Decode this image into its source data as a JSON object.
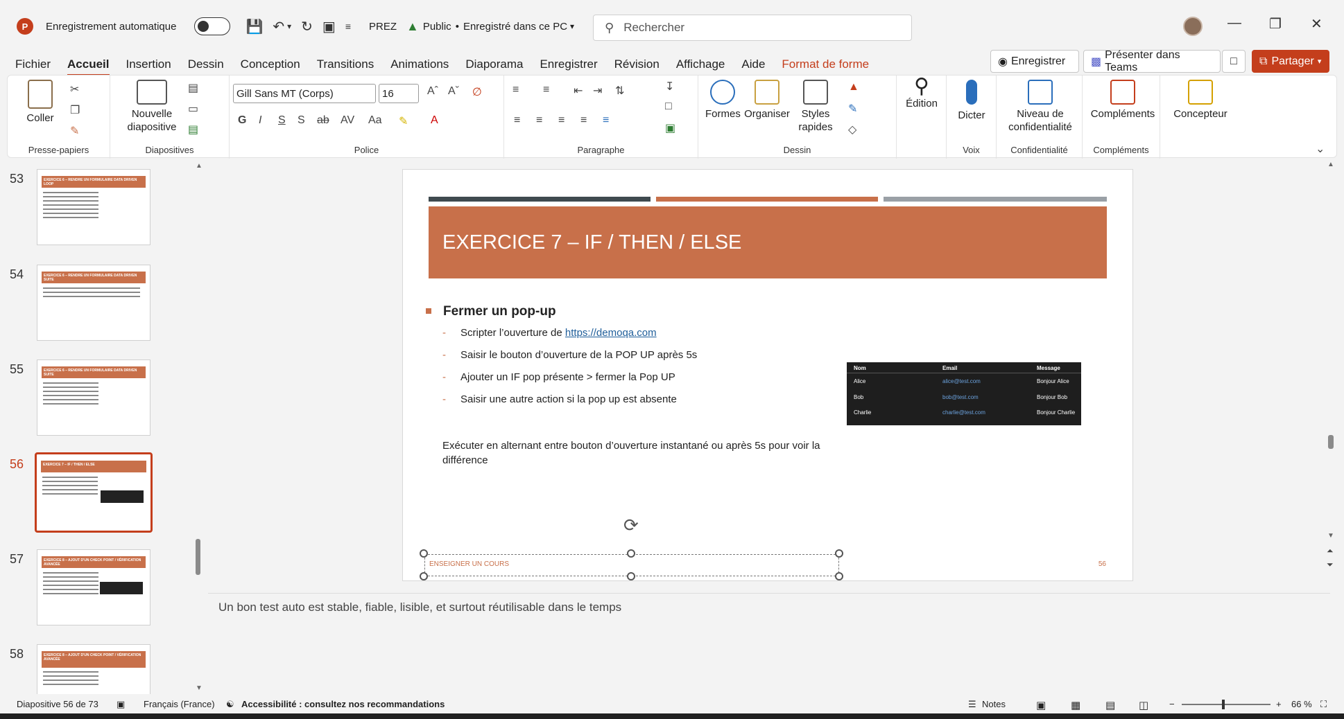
{
  "titlebar": {
    "app_icon": "P",
    "autosave_label": "Enregistrement automatique",
    "doc_name": "PREZ",
    "sensitivity": "Public",
    "separator": "•",
    "save_state": "Enregistré dans ce PC",
    "search_placeholder": "Rechercher",
    "icons": [
      "save-icon",
      "undo-icon",
      "redo-icon",
      "present-icon",
      "customize-icon"
    ]
  },
  "menu": {
    "items": [
      "Fichier",
      "Accueil",
      "Insertion",
      "Dessin",
      "Conception",
      "Transitions",
      "Animations",
      "Diaporama",
      "Enregistrer",
      "Révision",
      "Affichage",
      "Aide",
      "Format de forme"
    ],
    "record_button": "Enregistrer",
    "teams_button": "Présenter dans Teams",
    "share_button": "Partager"
  },
  "ribbon": {
    "groups": {
      "clipboard": "Presse-papiers",
      "slides": "Diapositives",
      "font": "Police",
      "paragraph": "Paragraphe",
      "drawing": "Dessin",
      "voice": "Voix",
      "confidentiality": "Confidentialité",
      "addins": "Compléments"
    },
    "paste_label": "Coller",
    "new_slide_label": "Nouvelle",
    "new_slide_label2": "diapositive",
    "font_name": "Gill Sans MT (Corps)",
    "font_size": "16",
    "shapes_label": "Formes",
    "arrange_label": "Organiser",
    "styles_label": "Styles",
    "styles_label2": "rapides",
    "edit_label": "Édition",
    "dictate_label": "Dicter",
    "sensitivity_label": "Niveau de",
    "sensitivity_label2": "confidentialité",
    "addins_label": "Compléments",
    "designer_label": "Concepteur"
  },
  "thumbnails": [
    {
      "num": "53",
      "title": "EXERCICE 6 – RENDRE UN FORMULAIRE DATA DRIVEN LOOP"
    },
    {
      "num": "54",
      "title": "EXERCICE 6 – RENDRE UN FORMULAIRE DATA DRIVEN SUITE"
    },
    {
      "num": "55",
      "title": "EXERCICE 6 – RENDRE UN FORMULAIRE DATA DRIVEN SUITE"
    },
    {
      "num": "56",
      "title": "EXERCICE 7 – IF / THEN / ELSE"
    },
    {
      "num": "57",
      "title": "EXERCICE 8 – AJOUT D'UN CHECK POINT / VÉRIFICATION AVANCÉE"
    },
    {
      "num": "58",
      "title": "EXERCICE 8 – AJOUT D'UN CHECK POINT / VÉRIFICATION AVANCÉE"
    }
  ],
  "slide": {
    "title": "EXERCICE 7 – IF  / THEN / ELSE",
    "main_bullet": "Fermer un pop-up",
    "sub1_prefix": "Scripter l’ouverture de ",
    "sub1_link": "https://demoqa.com",
    "sub2": "Saisir le bouton d’ouverture de la POP UP après 5s",
    "sub3": "Ajouter un IF pop présente > fermer la Pop UP",
    "sub4": "Saisir une autre action si la pop up est absente",
    "note": "Exécuter en alternant entre bouton d’ouverture instantané ou après 5s pour voir la différence",
    "footer": "ENSEIGNER UN COURS",
    "page_number": "56",
    "table": {
      "headers": [
        "Nom",
        "Email",
        "Message"
      ],
      "rows": [
        [
          "Alice",
          "alice@test.com",
          "Bonjour Alice"
        ],
        [
          "Bob",
          "bob@test.com",
          "Bonjour Bob"
        ],
        [
          "Charlie",
          "charlie@test.com",
          "Bonjour Charlie"
        ]
      ]
    },
    "colors": {
      "accent": "#c8704a",
      "bar1": "#3f4a4f",
      "bar2": "#c8704a",
      "bar3": "#9aa0a6"
    }
  },
  "notes_text": "Un bon test auto est stable, fiable, lisible, et surtout réutilisable dans le temps",
  "status": {
    "slide_info": "Diapositive 56 de 73",
    "language": "Français (France)",
    "accessibility": "Accessibilité : consultez nos recommandations",
    "notes_label": "Notes",
    "zoom": "66 %"
  }
}
